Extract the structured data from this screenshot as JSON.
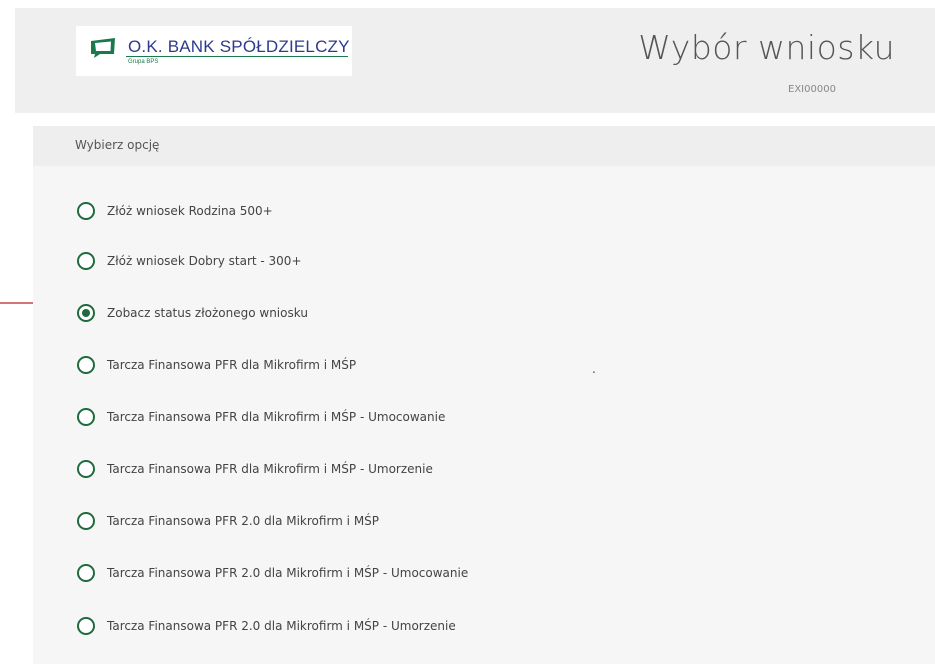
{
  "header": {
    "logo": {
      "name": "O.K. BANK SPÓŁDZIELCZY",
      "subtitle": "Grupa BPS",
      "mark_color": "#1a7a4d",
      "text_color": "#2c3b8c"
    },
    "title": "Wybór wniosku",
    "code": "EXI00000"
  },
  "panel": {
    "heading": "Wybierz opcję",
    "options": [
      {
        "label": "Złóż wniosek Rodzina 500+",
        "selected": false
      },
      {
        "label": "Złóż wniosek Dobry start - 300+",
        "selected": false
      },
      {
        "label": "Zobacz status złożonego wniosku",
        "selected": true
      },
      {
        "label": "Tarcza Finansowa PFR dla Mikrofirm i MŚP",
        "selected": false
      },
      {
        "label": "Tarcza Finansowa PFR dla Mikrofirm i MŚP - Umocowanie",
        "selected": false
      },
      {
        "label": "Tarcza Finansowa PFR dla Mikrofirm i MŚP - Umorzenie",
        "selected": false
      },
      {
        "label": "Tarcza Finansowa PFR 2.0 dla Mikrofirm i MŚP",
        "selected": false
      },
      {
        "label": "Tarcza Finansowa PFR 2.0 dla Mikrofirm i MŚP - Umocowanie",
        "selected": false
      },
      {
        "label": "Tarcza Finansowa PFR 2.0 dla Mikrofirm i MŚP - Umorzenie",
        "selected": false
      }
    ],
    "stray_text": "."
  },
  "colors": {
    "accent": "#1f6b3f",
    "arrow": "#b0262b",
    "header_bg": "#efefef",
    "panel_bg": "#f6f6f6"
  },
  "icons": {
    "annotation": "arrow-right-icon"
  }
}
